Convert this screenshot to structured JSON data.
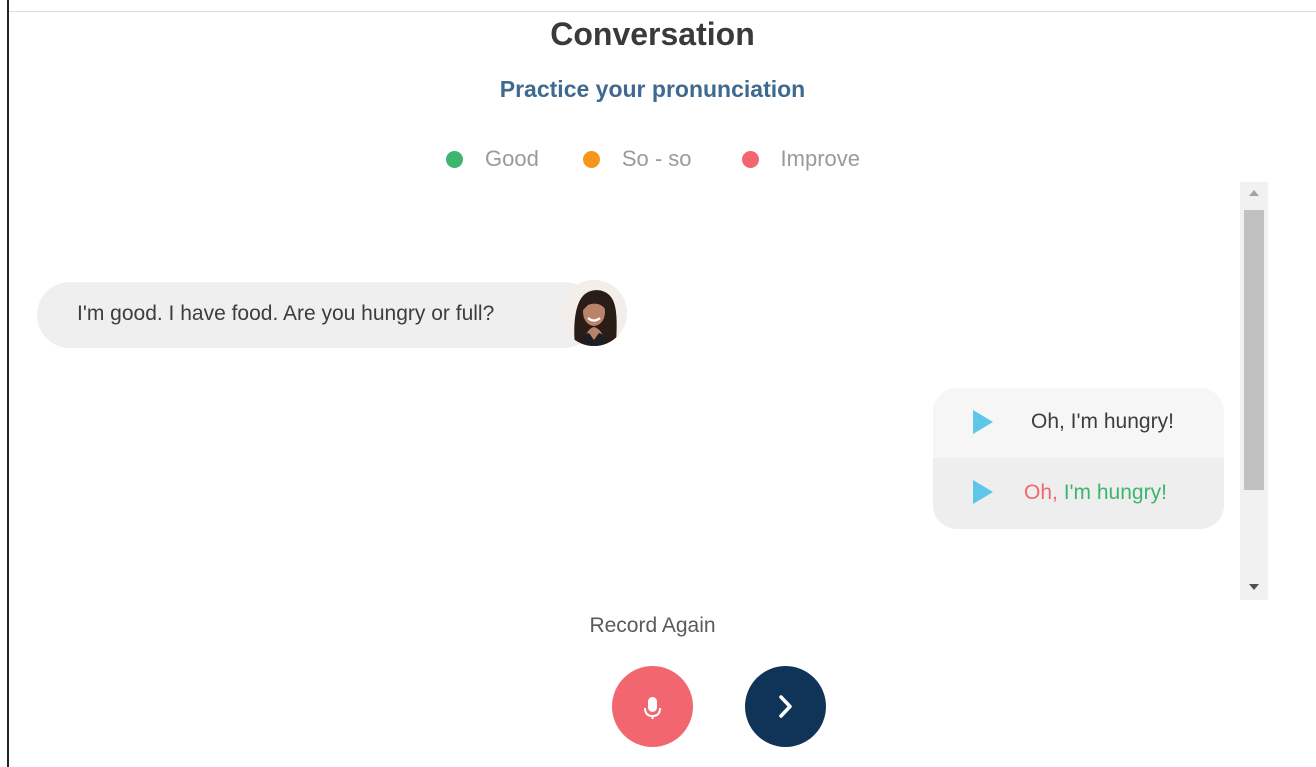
{
  "header": {
    "title": "Conversation",
    "subtitle": "Practice your pronunciation"
  },
  "legend": [
    {
      "label": "Good",
      "color": "#3cb66e"
    },
    {
      "label": "So - so",
      "color": "#f7951d"
    },
    {
      "label": "Improve",
      "color": "#f26670"
    }
  ],
  "conversation": {
    "tutor_message": "I'm good. I have food. Are you hungry or full?",
    "user_reply": {
      "expected_text": "Oh, I'm hungry!",
      "graded_words": [
        {
          "text": "Oh,",
          "grade": "improve",
          "color": "#f26670"
        },
        {
          "text": " I'm hungry!",
          "grade": "good",
          "color": "#3cb66e"
        }
      ]
    }
  },
  "controls": {
    "record_label": "Record Again",
    "mic_icon": "microphone-icon",
    "next_icon": "chevron-right-icon"
  },
  "colors": {
    "accent_play": "#5ec6e8",
    "mic_button": "#f26670",
    "next_button": "#0f3457"
  }
}
